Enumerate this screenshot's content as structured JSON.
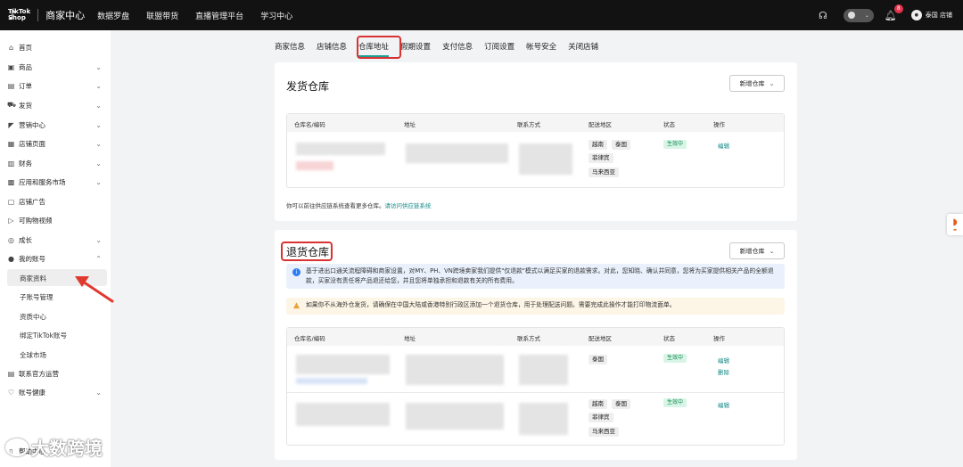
{
  "topbar": {
    "logo_line1": "TikTok",
    "logo_line2": "Shop",
    "center": "商家中心",
    "nav": [
      "数据罗盘",
      "联盟带货",
      "直播管理平台",
      "学习中心"
    ],
    "notification_count": "8",
    "user_name": "泰国 店铺"
  },
  "sidebar": {
    "items": [
      {
        "label": "首页",
        "icon": "home-icon"
      },
      {
        "label": "商品",
        "icon": "product-icon"
      },
      {
        "label": "订单",
        "icon": "order-icon"
      },
      {
        "label": "发货",
        "icon": "truck-icon"
      },
      {
        "label": "营销中心",
        "icon": "megaphone-icon"
      },
      {
        "label": "店铺页面",
        "icon": "store-icon"
      },
      {
        "label": "财务",
        "icon": "finance-icon"
      },
      {
        "label": "应用和服务市场",
        "icon": "apps-icon"
      },
      {
        "label": "店铺广告",
        "icon": "ads-icon"
      },
      {
        "label": "可购物视频",
        "icon": "video-icon"
      },
      {
        "label": "成长",
        "icon": "growth-icon"
      },
      {
        "label": "我的账号",
        "icon": "user-icon"
      }
    ],
    "account_subitems": [
      "商家资料",
      "子账号管理",
      "资质中心",
      "绑定TikTok账号",
      "全球市场"
    ],
    "bottom_items": [
      {
        "label": "联系官方运营",
        "icon": "contact-icon"
      },
      {
        "label": "账号健康",
        "icon": "health-icon"
      },
      {
        "label": "帮助中心",
        "icon": "help-icon"
      }
    ]
  },
  "tabs": [
    "商家信息",
    "店铺信息",
    "仓库地址",
    "假期设置",
    "支付信息",
    "订阅设置",
    "帐号安全",
    "关闭店铺"
  ],
  "active_tab": "仓库地址",
  "columns": [
    "仓库名/编码",
    "地址",
    "联系方式",
    "配送地区",
    "状态",
    "操作"
  ],
  "shipping": {
    "title": "发货仓库",
    "new_button": "新增仓库",
    "row": {
      "regions": [
        "越南",
        "泰国",
        "菲律宾",
        "马来西亚"
      ],
      "status": "生效中",
      "action": "编辑"
    },
    "note": "你可以前往供应链系统查看更多仓库。",
    "note_link": "请访问供应链系统"
  },
  "returns": {
    "title": "退货仓库",
    "new_button": "新增仓库",
    "info_alert": "基于进出口通关流程障碍和商家设置，对MY、PH、VN跨境卖家我们提供\"仅退款\"模式以满足买家的退款需求。对此，您知晓、确认并同意，您将为买家提供相关产品的全额退款，买家没有责任将产品退还给您，并且您将单独承担和退款有关的所有费用。",
    "warn_alert": "如果你不从海外仓发货，请确保在中国大陆或香港特别行政区添加一个退货仓库，用于处理配送问题。需要完成此操作才能打印物流面单。",
    "rows": [
      {
        "regions": [
          "泰国"
        ],
        "status": "生效中",
        "actions": [
          "编辑",
          "删除"
        ]
      },
      {
        "regions": [
          "越南",
          "泰国",
          "菲律宾",
          "马来西亚"
        ],
        "status": "生效中",
        "actions": [
          "编辑"
        ]
      }
    ]
  },
  "watermark": "大数跨境",
  "colors": {
    "accent": "#1a9e96",
    "highlight": "#d93232",
    "topbar": "#121212"
  }
}
